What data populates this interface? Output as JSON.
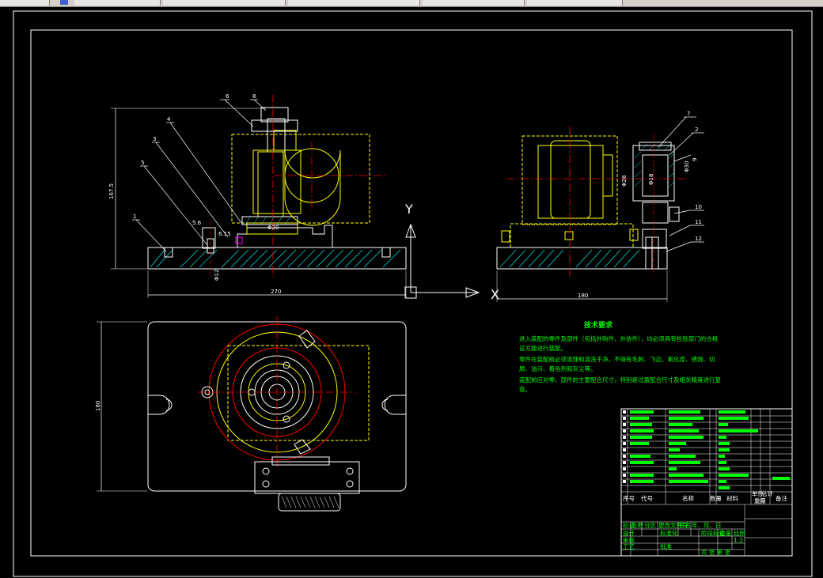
{
  "window": {
    "tabs": [
      "",
      "",
      "",
      "",
      "",
      ""
    ]
  },
  "front_view": {
    "dim_height": "167.5",
    "dim_width": "270",
    "dim_small_1": "5.6",
    "dim_small_2": "6.15",
    "dim_small_3": "Φ12",
    "dim_bore": "Φ20",
    "leaders": [
      "6",
      "8",
      "4",
      "3",
      "5",
      "1"
    ]
  },
  "side_view": {
    "dim_width": "180",
    "dim_left": "Φ28",
    "dim_mid": "Φ18",
    "dim_right": "Φ30",
    "leaders": [
      "7",
      "2",
      "9",
      "10",
      "11",
      "12"
    ]
  },
  "plan_view": {
    "dim_height": "180"
  },
  "ucs": {
    "y_label": "Y",
    "x_label": "X"
  },
  "tech_requirements": {
    "title": "技术要求",
    "lines": [
      "进入装配的零件及部件（包括外购件、外协件），均必须具有检验部门的合格",
      "证方能进行装配。",
      "零件在装配前必须清理和清洗干净，不得有毛刺、飞边、氧化皮、锈蚀、切",
      "屑、油污、着色剂和灰尘等。",
      "装配前应对零、部件的主要配合尺寸，特别是过盈配合尺寸及相关精度进行复",
      "查。"
    ]
  },
  "title_block": {
    "header": {
      "seq": "序号",
      "code": "代号",
      "name": "名称",
      "qty": "数量",
      "material": "材料",
      "unit_weight": "单件",
      "total_weight": "总计",
      "weight": "重量",
      "remark": "备注"
    },
    "bottom": {
      "mark": "标记",
      "count": "处数",
      "zone": "分区",
      "doc": "更改文件号",
      "sign": "签名",
      "date": "年、月、日",
      "design": "设计",
      "std": "标准化",
      "review": "审核",
      "process": "工艺",
      "approve": "批准",
      "stage": "阶段标记",
      "weight": "重量",
      "scale": "比例",
      "scale_value": "1:2",
      "sheets": "共  张  第  张"
    }
  },
  "colors": {
    "outline": "#ffffff",
    "hidden": "#ffff00",
    "center": "#ff0000",
    "note": "#00ff00",
    "dim": "#00ffff"
  }
}
